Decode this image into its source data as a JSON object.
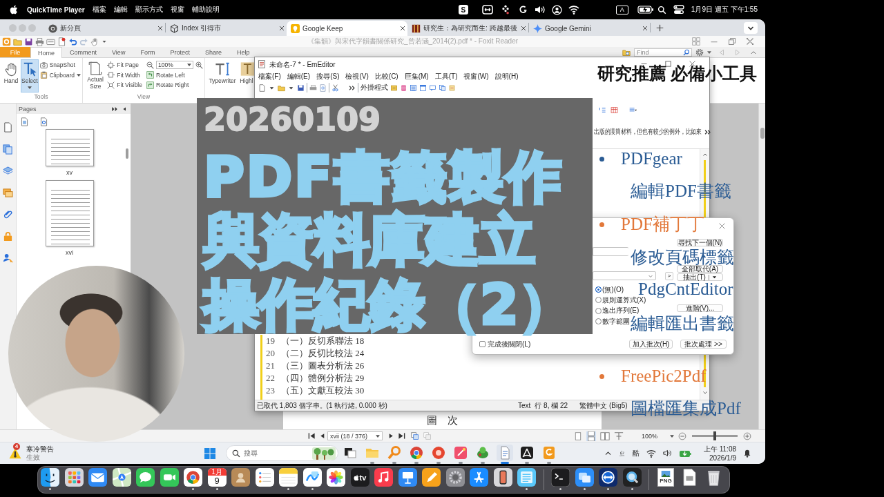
{
  "menu_bar": {
    "app_name": "QuickTime Player",
    "menus": [
      "檔案",
      "編輯",
      "顯示方式",
      "視窗",
      "輔助說明"
    ],
    "status_letter": "S",
    "input_source": "A",
    "clock": "1月9日 週五 下午1:55"
  },
  "browser": {
    "tabs": [
      {
        "title": "新分頁",
        "kind": "ring",
        "selected": false
      },
      {
        "title": "Index 引得市",
        "kind": "cube",
        "selected": false
      },
      {
        "title": "Google Keep",
        "kind": "bulb",
        "selected": true
      },
      {
        "title": "研究生：為研究而生: 跨越最後",
        "kind": "book",
        "selected": false
      },
      {
        "title": "Google Gemini",
        "kind": "sparkle",
        "selected": false
      }
    ]
  },
  "foxit": {
    "title": "《集韻》與宋代字韻書關係研究_曾若涵_2014(2).pdf * - Foxit Reader",
    "ribbon_tabs": [
      {
        "label": "File",
        "kind": "file",
        "selected": false
      },
      {
        "label": "Home",
        "kind": "tab",
        "selected": true
      },
      {
        "label": "Comment",
        "kind": "tab",
        "selected": false
      },
      {
        "label": "View",
        "kind": "tab",
        "selected": false
      },
      {
        "label": "Form",
        "kind": "tab",
        "selected": false
      },
      {
        "label": "Protect",
        "kind": "tab",
        "selected": false
      },
      {
        "label": "Share",
        "kind": "tab",
        "selected": false
      },
      {
        "label": "Help",
        "kind": "tab",
        "selected": false
      }
    ],
    "find": {
      "placeholder": "Find"
    },
    "ribbon": {
      "tools": {
        "label": "Tools",
        "buttons": [
          {
            "label": "Hand",
            "kind": "hand",
            "selected": false
          },
          {
            "label": "Select",
            "kind": "select",
            "selected": true
          }
        ],
        "small": [
          {
            "label": "SnapShot",
            "kind": "camera"
          },
          {
            "label": "Clipboard",
            "kind": "clipboard"
          }
        ]
      },
      "view": {
        "label": "View",
        "actual_size": "Actual Size",
        "fit": [
          {
            "label": "Fit Page",
            "kind": "page"
          },
          {
            "label": "Fit Width",
            "kind": "width"
          },
          {
            "label": "Fit Visible",
            "kind": "visible"
          }
        ],
        "zoom": "100%",
        "rotate": [
          {
            "label": "Rotate Left",
            "kind": "left"
          },
          {
            "label": "Rotate Right",
            "kind": "right"
          }
        ]
      },
      "comment": {
        "buttons": [
          {
            "label": "Typewriter",
            "kind": "typewriter"
          },
          {
            "label": "Highl",
            "kind": "highlight"
          }
        ]
      }
    },
    "pages": {
      "title": "Pages",
      "thumbnails": [
        "xv",
        "xvi"
      ]
    },
    "document": {
      "heading": [
        "圖",
        "次"
      ]
    },
    "nav": {
      "page": "xvii (18 / 376)",
      "zoom": "100%",
      "zoom_slider": {
        "level": 0.5
      }
    }
  },
  "emeditor": {
    "title": "未命名-7 * - EmEditor",
    "menus": [
      "檔案(F)",
      "編輯(E)",
      "搜尋(S)",
      "檢視(V)",
      "比較(C)",
      "巨集(M)",
      "工具(T)",
      "視窗(W)",
      "說明(H)"
    ],
    "plugins_label": "外掛程式",
    "bookmark_text": "出版的漢簡材料，但也有較少的例外，比如來",
    "lines": [
      {
        "number": "19",
        "text": "（一）反切系聯法 18"
      },
      {
        "number": "20",
        "text": "（二）反切比較法 24"
      },
      {
        "number": "21",
        "text": "（三）圖表分析法 26"
      },
      {
        "number": "22",
        "text": "（四）體例分析法 29"
      },
      {
        "number": "23",
        "text": "（五）文獻互較法 30"
      }
    ],
    "status": {
      "message": "已取代 1,803 個字串。(1 執行緒, 0.000 秒)",
      "mode": "Text",
      "cursor": "行 8, 欄 22",
      "encoding": "繁體中文 (Big5)"
    }
  },
  "dialog": {
    "expand_button": ">",
    "side_buttons": [
      {
        "label": "尋找下一個(N)",
        "kind": "plain"
      },
      {
        "label": "全部取代(A)",
        "kind": "plain"
      },
      {
        "label": "抽出(T)",
        "kind": "split"
      },
      {
        "label": "進階(V)...",
        "kind": "plain"
      }
    ],
    "radios": [
      {
        "label": "(無)(O)",
        "selected": true
      },
      {
        "label": "規則運算式(X)",
        "selected": false
      },
      {
        "label": "逸出序列(E)",
        "selected": false
      },
      {
        "label": "數字範圍",
        "selected": false
      }
    ],
    "close_when_done": {
      "label": "完成後關閉(L)",
      "checked": false
    },
    "batch_buttons": [
      "加入批次(H)",
      "批次處理 >>"
    ]
  },
  "title_card": {
    "date": "20260109",
    "lines": [
      "PDF書籤製作",
      "與資料庫建立",
      "操作紀錄（2）"
    ]
  },
  "captions": {
    "heading": "研究推薦 必備小工具",
    "lines": [
      {
        "kind": "bullet",
        "text": "PDFgear",
        "color": "#2b5c94"
      },
      {
        "kind": "note",
        "text": "編輯PDF書籤"
      },
      {
        "kind": "bullet",
        "text": "PDF補丁丁",
        "color": "#e2783a"
      },
      {
        "kind": "note",
        "text": "修改頁碼標籤"
      },
      {
        "kind": "plain",
        "text": "PdgCntEditor"
      },
      {
        "kind": "note",
        "text": "編輯匯出書籤"
      },
      {
        "kind": "bullet",
        "text": "FreePic2Pdf",
        "color": "#e2783a"
      },
      {
        "kind": "note",
        "text": "圖檔匯集成Pdf"
      }
    ]
  },
  "taskbar": {
    "weather": {
      "badge": "4",
      "title": "寒冷警告",
      "subtitle": "生效"
    },
    "search": {
      "placeholder": "搜尋"
    },
    "apps": [
      {
        "kind": "task_view",
        "running": false,
        "active": false
      },
      {
        "kind": "folder",
        "running": true,
        "active": false
      },
      {
        "kind": "magnifier",
        "running": true,
        "active": false
      },
      {
        "kind": "browser",
        "running": true,
        "active": false
      },
      {
        "kind": "round_app",
        "running": true,
        "active": false
      },
      {
        "kind": "pen_app",
        "running": true,
        "active": false
      },
      {
        "kind": "creature",
        "running": true,
        "active": false
      },
      {
        "kind": "document",
        "running": true,
        "active": true
      },
      {
        "kind": "swoosh",
        "running": true,
        "active": false
      },
      {
        "kind": "swirl",
        "running": true,
        "active": false
      }
    ],
    "tray": {
      "ime": [
        "ㄓ",
        "酷"
      ],
      "time": "上午 11:08",
      "date": "2026/1/9"
    }
  },
  "dock": {
    "apps": [
      {
        "kind": "finder",
        "running": true
      },
      {
        "kind": "launchpad",
        "running": false
      },
      {
        "kind": "mail",
        "running": false
      },
      {
        "kind": "maps",
        "running": false
      },
      {
        "kind": "messages",
        "running": false
      },
      {
        "kind": "facetime",
        "running": false
      },
      {
        "kind": "chrome",
        "running": true
      },
      {
        "kind": "calendar",
        "running": true,
        "month": "1月",
        "day": "9"
      },
      {
        "kind": "contacts",
        "running": false
      },
      {
        "kind": "reminders",
        "running": false
      },
      {
        "kind": "notes",
        "running": true
      },
      {
        "kind": "freeform",
        "running": true
      },
      {
        "kind": "photos",
        "running": false
      },
      {
        "kind": "tv",
        "running": false,
        "label": "tv"
      },
      {
        "kind": "music",
        "running": false
      },
      {
        "kind": "keynote",
        "running": false
      },
      {
        "kind": "pages",
        "running": false
      },
      {
        "kind": "settings",
        "running": false
      },
      {
        "kind": "appstore",
        "running": false
      },
      {
        "kind": "mirroring",
        "running": false
      },
      {
        "kind": "list_app",
        "running": true
      },
      {
        "kind": "separator"
      },
      {
        "kind": "terminal",
        "running": true
      },
      {
        "kind": "windows_app",
        "running": true
      },
      {
        "kind": "remote",
        "running": true
      },
      {
        "kind": "quicktime",
        "running": true
      },
      {
        "kind": "separator"
      },
      {
        "kind": "png_file",
        "label": "PNG"
      },
      {
        "kind": "file"
      },
      {
        "kind": "trash"
      }
    ]
  }
}
